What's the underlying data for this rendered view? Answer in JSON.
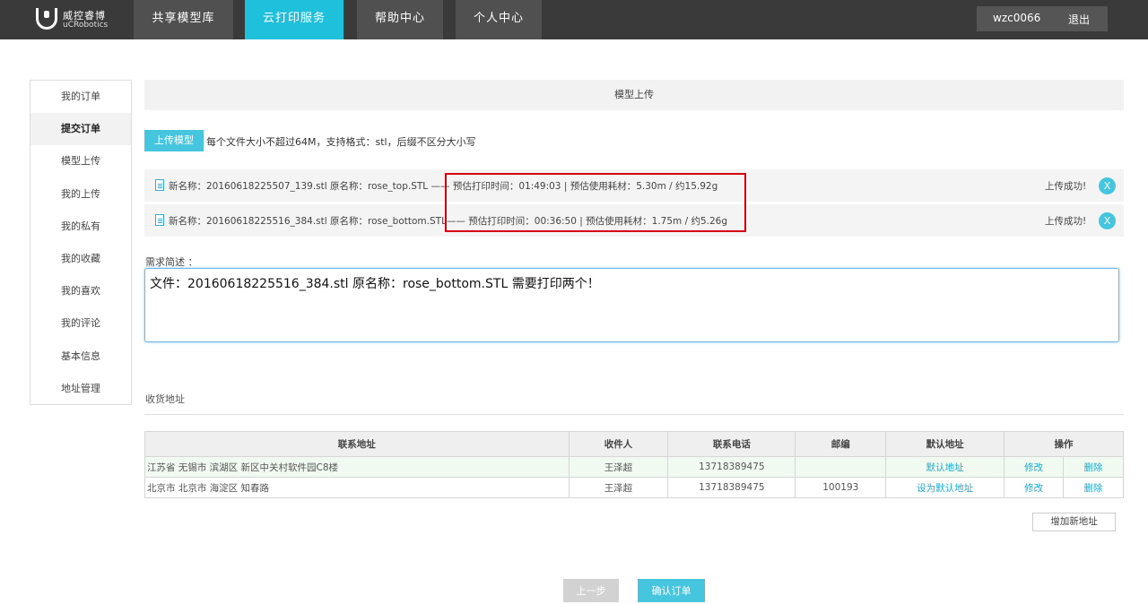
{
  "brand": {
    "name_cn": "威控睿博",
    "name_en": "uCRobotics"
  },
  "nav": {
    "items": [
      {
        "label": "共享模型库"
      },
      {
        "label": "云打印服务"
      },
      {
        "label": "帮助中心"
      },
      {
        "label": "个人中心"
      }
    ],
    "active_index": 1
  },
  "user": {
    "name": "wzc0066",
    "logout": "退出"
  },
  "sidebar": {
    "items": [
      {
        "label": "我的订单"
      },
      {
        "label": "提交订单"
      },
      {
        "label": "模型上传"
      },
      {
        "label": "我的上传"
      },
      {
        "label": "我的私有"
      },
      {
        "label": "我的收藏"
      },
      {
        "label": "我的喜欢"
      },
      {
        "label": "我的评论"
      },
      {
        "label": "基本信息"
      },
      {
        "label": "地址管理"
      }
    ],
    "active_index": 1
  },
  "upload": {
    "section_title": "模型上传",
    "button": "上传模型",
    "hint": "每个文件大小不超过64M，支持格式：stl，后缀不区分大小写",
    "files": [
      {
        "text": "新名称：20160618225507_139.stl 原名称：rose_top.STL —— 预估打印时间：01:49:03 | 预估使用耗材：5.30m / 约15.92g",
        "status": "上传成功!",
        "remove": "X"
      },
      {
        "text": "新名称：20160618225516_384.stl 原名称：rose_bottom.STL—— 预估打印时间：00:36:50 | 预估使用耗材：1.75m / 约5.26g",
        "status": "上传成功!",
        "remove": "X"
      }
    ]
  },
  "requirement": {
    "label": "需求简述 ：",
    "value": "文件：20160618225516_384.stl 原名称：rose_bottom.STL 需要打印两个！"
  },
  "address": {
    "title": "收货地址",
    "headers": [
      "联系地址",
      "收件人",
      "联系电话",
      "邮编",
      "默认地址",
      "操作"
    ],
    "rows": [
      {
        "addr": "江苏省 无锡市 滨湖区 新区中关村软件园C8楼",
        "name": "王泽超",
        "phone": "13718389475",
        "zip": "",
        "default": "默认地址",
        "edit": "修改",
        "delete": "删除"
      },
      {
        "addr": "北京市 北京市 海淀区 知春路",
        "name": "王泽超",
        "phone": "13718389475",
        "zip": "100193",
        "default": "设为默认地址",
        "edit": "修改",
        "delete": "删除"
      }
    ],
    "add_button": "增加新地址"
  },
  "footer": {
    "prev": "上一步",
    "confirm": "确认订单"
  },
  "colors": {
    "accent": "#1fc0dc",
    "button": "#45c6de",
    "highlight": "#d8000c"
  }
}
